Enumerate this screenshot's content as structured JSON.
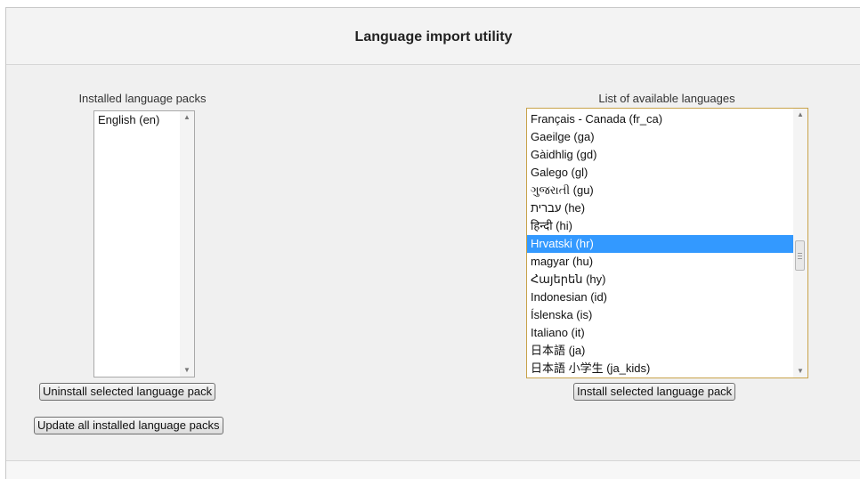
{
  "page": {
    "title": "Language import utility"
  },
  "installed": {
    "caption": "Installed language packs",
    "items": [
      "English (en)"
    ],
    "uninstall_label": "Uninstall selected language pack",
    "update_label": "Update all installed language packs"
  },
  "available": {
    "caption": "List of available languages",
    "items": [
      "Français - Canada (fr_ca)",
      "Gaeilge (ga)",
      "Gàidhlig (gd)",
      "Galego (gl)",
      "ગુજરાતી (gu)",
      "עברית (he)",
      "हिन्दी (hi)",
      "Hrvatski (hr)",
      "magyar (hu)",
      "Հայերեն (hy)",
      "Indonesian (id)",
      "Íslenska (is)",
      "Italiano (it)",
      "日本語 (ja)",
      "日本語 小学生 (ja_kids)"
    ],
    "selected_index": 7,
    "install_label": "Install selected language pack"
  },
  "colors": {
    "selection": "#3399ff",
    "focus_border": "#c8a34a"
  },
  "icons": {
    "scroll_up": "scroll-up-arrow-icon",
    "scroll_down": "scroll-down-arrow-icon",
    "thumb_grip": "scroll-grip-icon"
  }
}
